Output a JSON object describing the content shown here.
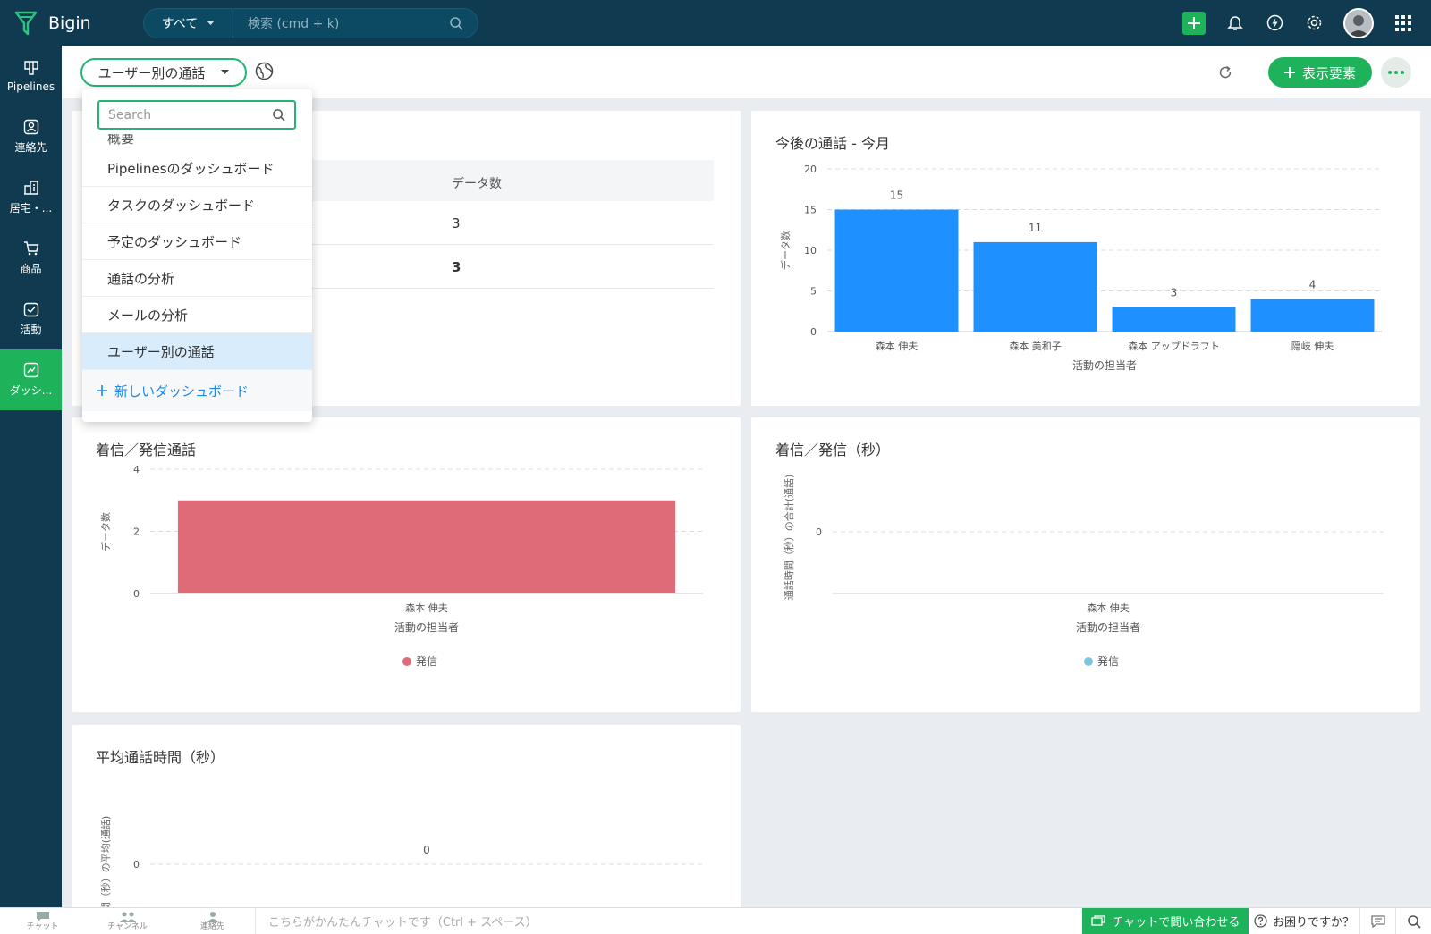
{
  "app": {
    "name": "Bigin"
  },
  "search": {
    "scope": "すべて",
    "placeholder": "検索 (cmd + k)"
  },
  "sidebar": {
    "items": [
      {
        "label": "Pipelines",
        "icon": "pipelines-icon"
      },
      {
        "label": "連絡先",
        "icon": "contacts-icon"
      },
      {
        "label": "居宅・...",
        "icon": "companies-icon"
      },
      {
        "label": "商品",
        "icon": "products-icon"
      },
      {
        "label": "活動",
        "icon": "activities-icon"
      },
      {
        "label": "ダッシ...",
        "icon": "dashboard-icon"
      }
    ]
  },
  "header": {
    "dashboard_name": "ユーザー別の通話",
    "show_elements_label": "表示要素"
  },
  "dropdown": {
    "search_placeholder": "Search",
    "cut_item": "概要",
    "items": [
      "Pipelinesのダッシュボード",
      "タスクのダッシュボード",
      "予定のダッシュボード",
      "通話の分析",
      "メールの分析",
      "ユーザー別の通話"
    ],
    "selected_index": 5,
    "new_dashboard_label": "新しいダッシュボード"
  },
  "table_card": {
    "column_header": "データ数",
    "rows": [
      "3",
      "3"
    ]
  },
  "chart_data": [
    {
      "type": "bar",
      "title": "今後の通話 - 今月",
      "xlabel": "活動の担当者",
      "ylabel": "データ数",
      "categories": [
        "森本 伸夫",
        "森本 美和子",
        "森本 アップドラフト",
        "隠岐 伸夫"
      ],
      "values": [
        15,
        11,
        3,
        4
      ],
      "ylim": [
        0,
        20
      ],
      "yticks": [
        0,
        5,
        10,
        15,
        20
      ],
      "color": "#1e90ff",
      "grid": true
    },
    {
      "type": "bar",
      "title": "着信／発信通話",
      "xlabel": "活動の担当者",
      "ylabel": "データ数",
      "categories": [
        "森本 伸夫"
      ],
      "series": [
        {
          "name": "発信",
          "values": [
            3
          ],
          "color": "#df6b79"
        }
      ],
      "ylim": [
        0,
        4
      ],
      "yticks": [
        0,
        2,
        4
      ],
      "legend": "bottom",
      "grid": true
    },
    {
      "type": "bar",
      "title": "着信／発信（秒）",
      "xlabel": "活動の担当者",
      "ylabel": "通話時間（秒）の合計(通話)",
      "categories": [
        "森本 伸夫"
      ],
      "series": [
        {
          "name": "発信",
          "values": [
            0
          ],
          "color": "#7ec4e0"
        }
      ],
      "yticks": [
        0
      ],
      "legend": "bottom",
      "grid": true
    },
    {
      "type": "bar",
      "title": "平均通話時間（秒）",
      "ylabel": "通話時間（秒）の平均(通話)",
      "values": [
        0
      ],
      "data_labels": [
        "0"
      ],
      "yticks": [
        0
      ],
      "grid": true
    }
  ],
  "bottombar": {
    "chat_label": "チャット",
    "channel_label": "チャンネル",
    "contacts_label": "連絡先",
    "chat_placeholder": "こちらがかんたんチャットです（Ctrl + スペース）",
    "contact_button": "チャットで問い合わせる",
    "help_label": "お困りですか？"
  },
  "colors": {
    "brand": "#1eb35a",
    "topbar": "#0f3a4f",
    "link": "#1f87e5"
  }
}
